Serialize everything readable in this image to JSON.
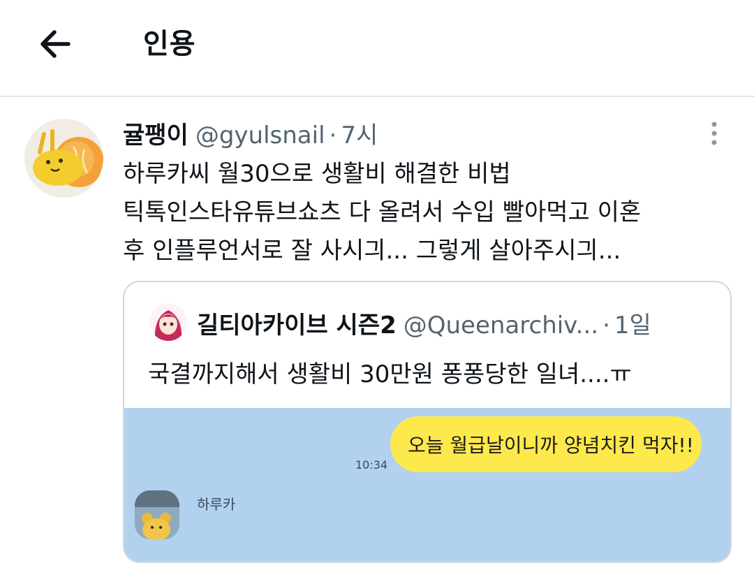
{
  "header": {
    "back_icon": "arrow-left-icon",
    "title": "인용"
  },
  "tweet": {
    "author_name": "귤팽이",
    "handle": "@gyulsnail",
    "separator": "·",
    "time": "7시",
    "more_icon": "more-vertical-icon",
    "text_lines": [
      "하루카씨 월30으로 생활비 해결한 비법",
      "틱톡인스타유튜브쇼츠 다 올려서 수입 빨아먹고 이혼",
      "후 인플루언서로 잘 사시긔... 그렇게 살아주시긔..."
    ]
  },
  "quote": {
    "author_name": "길티아카이브 시즌2",
    "handle": "@Queenarchiv...",
    "separator": "·",
    "time": "1일",
    "text": "국결까지해서 생활비 30만원 퐁퐁당한 일녀....ㅠ",
    "chat": {
      "message": "오늘 월급날이니까 양념치킨 먹자!!",
      "time": "10:34",
      "sender": "하루카"
    }
  },
  "colors": {
    "muted": "#536471",
    "divider": "#e1e4e8",
    "chat_background": "#b2d1ef",
    "bubble": "#fee94d"
  }
}
